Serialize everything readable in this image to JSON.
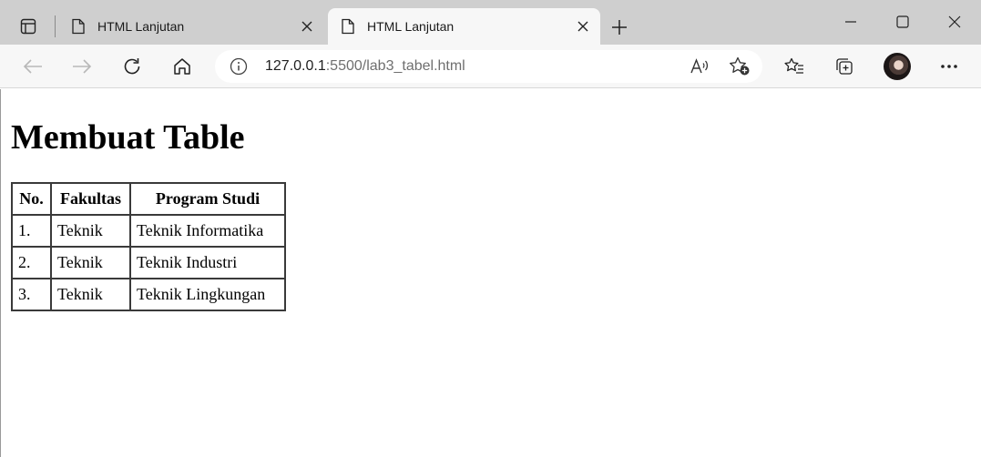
{
  "tabs": [
    {
      "title": "HTML Lanjutan",
      "active": false
    },
    {
      "title": "HTML Lanjutan",
      "active": true
    }
  ],
  "address": {
    "host": "127.0.0.1",
    "path": ":5500/lab3_tabel.html"
  },
  "page": {
    "heading": "Membuat Table",
    "table": {
      "headers": [
        "No.",
        "Fakultas",
        "Program Studi"
      ],
      "rows": [
        [
          "1.",
          "Teknik",
          "Teknik Informatika"
        ],
        [
          "2.",
          "Teknik",
          "Teknik Industri"
        ],
        [
          "3.",
          "Teknik",
          "Teknik Lingkungan"
        ]
      ]
    }
  },
  "icons": {
    "tab_actions": "tab-actions-icon",
    "page": "page-icon",
    "close": "close-icon",
    "new_tab": "plus-icon",
    "back": "back-arrow-icon",
    "forward": "forward-arrow-icon",
    "refresh": "refresh-icon",
    "home": "home-icon",
    "site_info": "info-icon",
    "read_aloud": "read-aloud-icon",
    "add_favorite": "star-plus-icon",
    "favorites": "favorites-icon",
    "collections": "collections-icon",
    "more": "more-icon"
  },
  "colors": {
    "tabbar": "#cfcfcf",
    "active_tab": "#f7f7f7",
    "toolbar": "#f7f7f7"
  }
}
